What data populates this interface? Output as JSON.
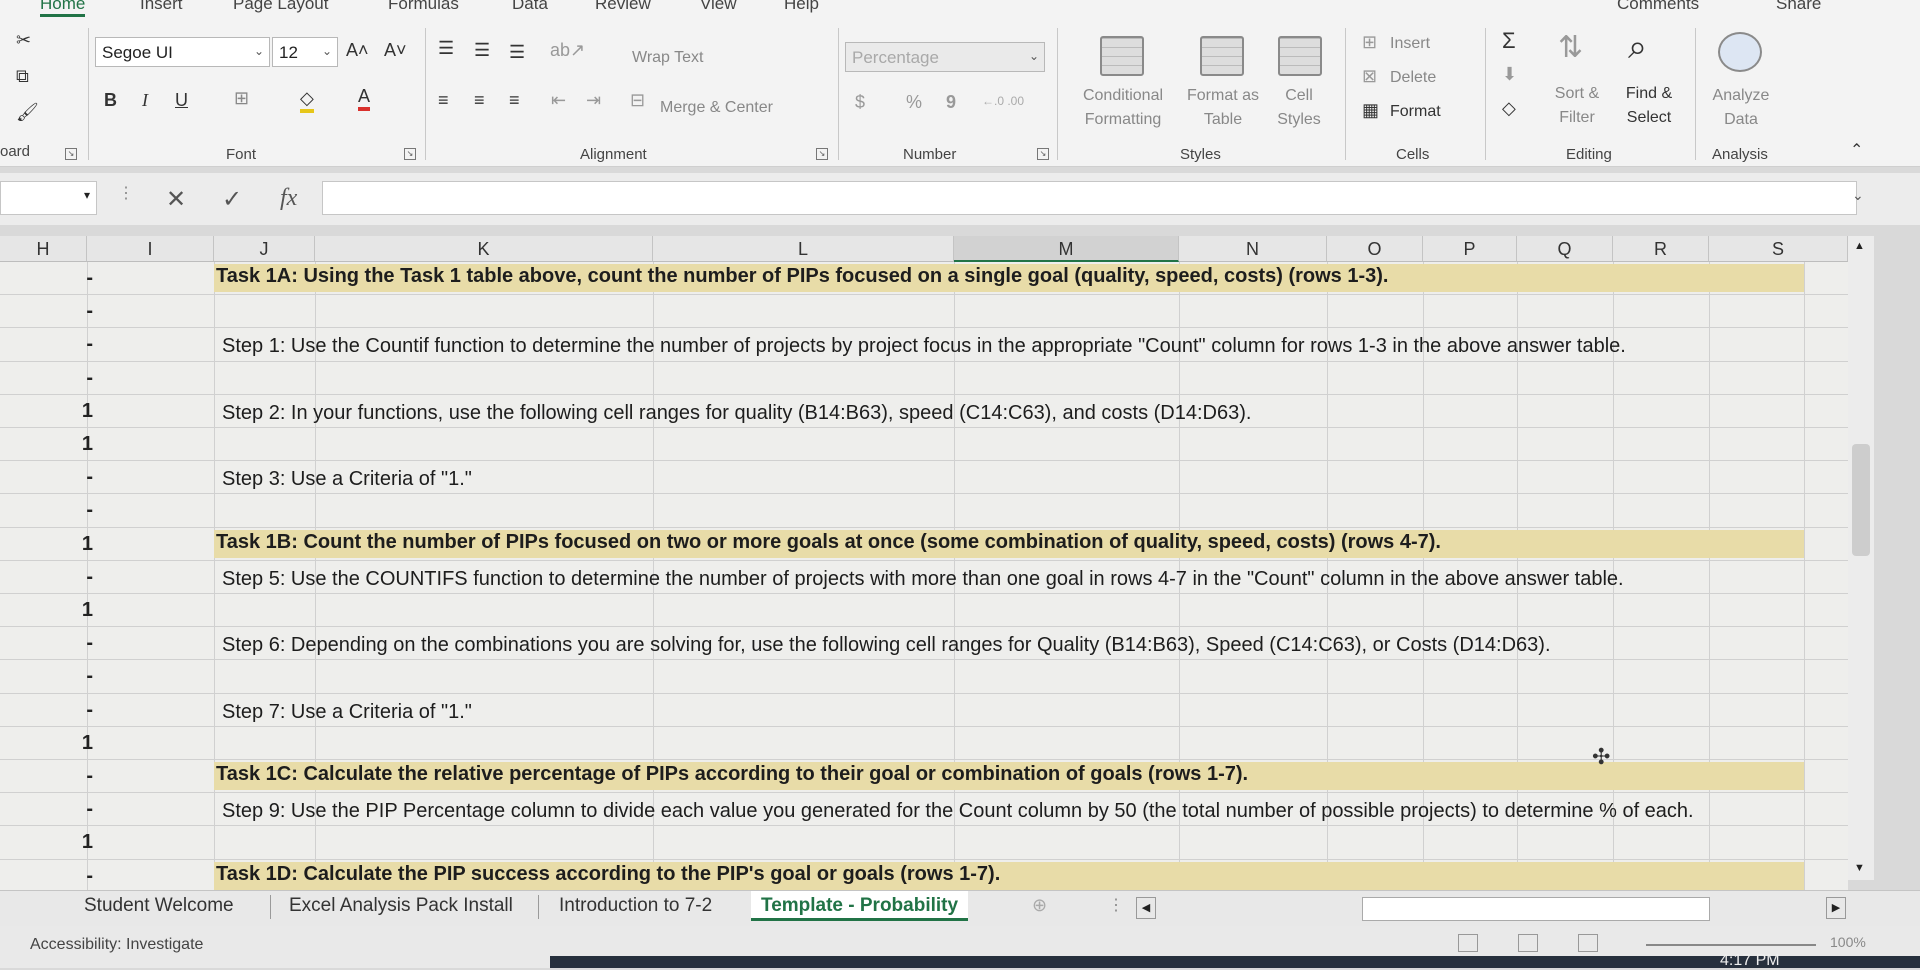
{
  "tabs": [
    "Home",
    "Insert",
    "Page Layout",
    "Formulas",
    "Data",
    "Review",
    "View",
    "Help"
  ],
  "header_right": {
    "comments": "Comments",
    "share": "Share"
  },
  "ribbon": {
    "clipboard_label": "oard",
    "font": {
      "name": "Segoe UI",
      "size": "12",
      "label": "Font",
      "bold": "B",
      "italic": "I",
      "underline": "U",
      "grow": "A˄",
      "shrink": "A˅"
    },
    "alignment": {
      "wrap_text": "Wrap Text",
      "merge_center": "Merge & Center",
      "label": "Alignment"
    },
    "number": {
      "format": "Percentage",
      "currency": "$",
      "percent": "%",
      "comma": "9",
      "label": "Number"
    },
    "styles": {
      "conditional_1": "Conditional",
      "conditional_2": "Formatting",
      "format_table_1": "Format as",
      "format_table_2": "Table",
      "cell_styles_1": "Cell",
      "cell_styles_2": "Styles",
      "label": "Styles"
    },
    "cells": {
      "insert": "Insert",
      "delete": "Delete",
      "format": "Format",
      "label": "Cells"
    },
    "editing": {
      "sort_1": "Sort &",
      "sort_2": "Filter",
      "find_1": "Find &",
      "find_2": "Select",
      "label": "Editing"
    },
    "analysis": {
      "analyze_1": "Analyze",
      "analyze_2": "Data",
      "label": "Analysis"
    }
  },
  "formula_bar": {
    "cancel": "✕",
    "enter": "✓",
    "fx": "fx",
    "value": ""
  },
  "columns": [
    "H",
    "I",
    "J",
    "K",
    "L",
    "M",
    "N",
    "O",
    "P",
    "Q",
    "R",
    "S"
  ],
  "rows": [
    {
      "h": "-",
      "text": "Task 1A:  Using the Task 1 table above, count the number of PIPs focused on a single goal (quality, speed, costs) (rows 1-3).",
      "bold": true
    },
    {
      "h": "-",
      "text": ""
    },
    {
      "h": "-",
      "text": "Step 1: Use the Countif function to determine the number of projects by project focus in the appropriate \"Count\" column for rows 1-3 in the above answer table."
    },
    {
      "h": "-",
      "text": ""
    },
    {
      "h": "1",
      "text": "Step 2: In your functions, use the following cell ranges for quality (B14:B63), speed (C14:C63), and costs (D14:D63)."
    },
    {
      "h": "1",
      "text": ""
    },
    {
      "h": "-",
      "text": "Step 3: Use a Criteria of \"1.\""
    },
    {
      "h": "-",
      "text": ""
    },
    {
      "h": "1",
      "text": "Task 1B:  Count the number of PIPs focused on two or more goals at once (some combination of quality, speed, costs) (rows 4-7).",
      "bold": true
    },
    {
      "h": "-",
      "text": "Step 5: Use the COUNTIFS function to determine the number of projects with more than one goal in rows 4-7 in the  \"Count\" column in the above answer table."
    },
    {
      "h": "1",
      "text": ""
    },
    {
      "h": "-",
      "text": "Step 6: Depending on the combinations you are solving for, use the following cell ranges for Quality (B14:B63), Speed (C14:C63), or Costs (D14:D63)."
    },
    {
      "h": "-",
      "text": ""
    },
    {
      "h": "-",
      "text": "Step 7: Use a Criteria of \"1.\""
    },
    {
      "h": "1",
      "text": ""
    },
    {
      "h": "-",
      "text": "Task 1C:  Calculate the relative percentage of PIPs according to their goal or combination of goals (rows 1-7).",
      "bold": true
    },
    {
      "h": "-",
      "text": "Step 9: Use the PIP Percentage column to divide each value you generated for the Count column by 50 (the total number of possible projects) to determine % of each."
    },
    {
      "h": "1",
      "text": ""
    },
    {
      "h": "-",
      "text": "Task 1D:  Calculate the PIP success according to the PIP's goal or goals (rows 1-7).",
      "bold": true
    }
  ],
  "sheet_tabs": [
    "Student Welcome",
    "Excel Analysis Pack Install",
    "Introduction to 7-2",
    "Template - Probability"
  ],
  "active_sheet": "Template - Probability",
  "status": {
    "accessibility": "Accessibility: Investigate",
    "zoom": "100%",
    "time": "4:17 PM"
  }
}
